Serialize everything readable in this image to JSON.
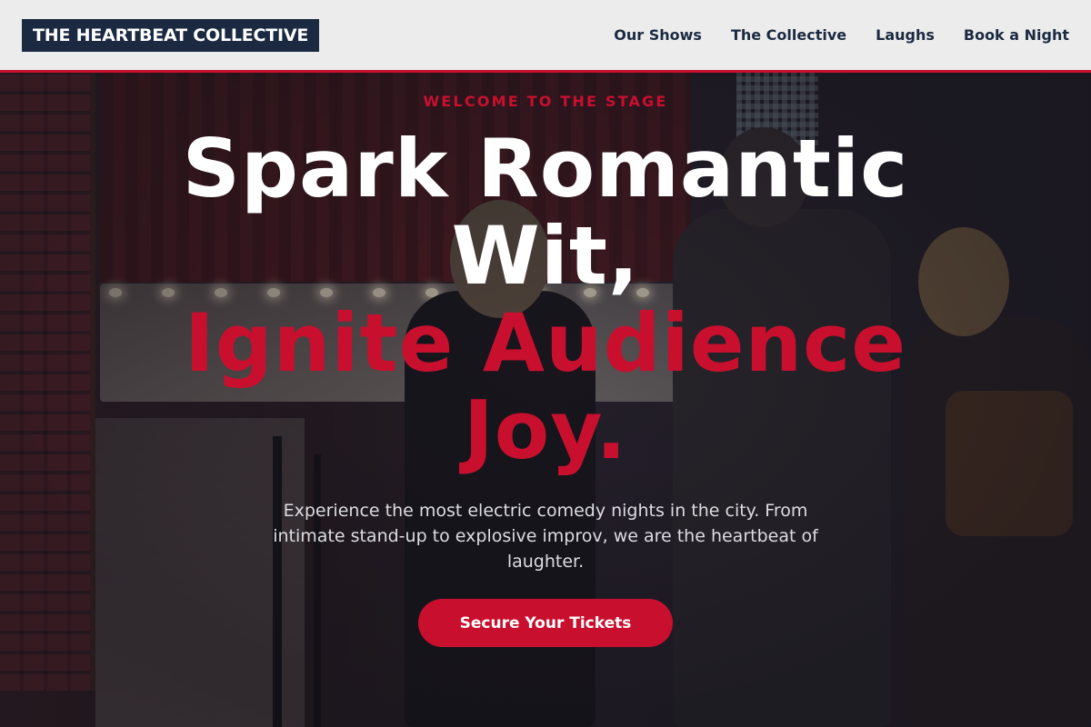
{
  "header": {
    "brand": "THE HEARTBEAT COLLECTIVE",
    "nav": [
      {
        "label": "Our Shows"
      },
      {
        "label": "The Collective"
      },
      {
        "label": "Laughs"
      },
      {
        "label": "Book a Night"
      }
    ]
  },
  "hero": {
    "eyebrow": "WELCOME TO THE STAGE",
    "headline_white": "Spark Romantic Wit,",
    "headline_red": "Ignite Audience Joy.",
    "lead": "Experience the most electric comedy nights in the city. From intimate stand-up to explosive improv, we are the heartbeat of laughter.",
    "cta_label": "Secure Your Tickets",
    "background_image": "comedy-club-entrance-photo"
  },
  "colors": {
    "accent": "#c8102e",
    "brand_bg": "#1b2a41",
    "header_bg": "#ececec",
    "text_light": "#ffffff"
  }
}
